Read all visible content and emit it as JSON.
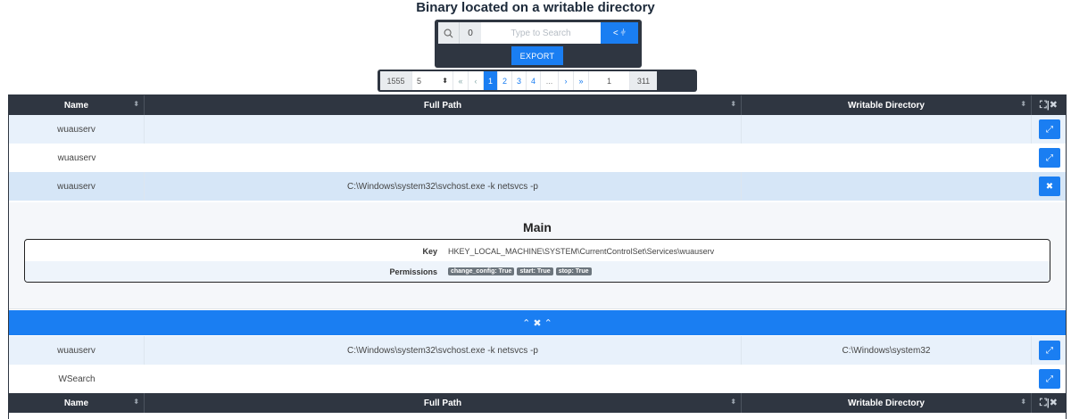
{
  "page": {
    "title": "Binary located on a writable directory"
  },
  "search": {
    "count": "0",
    "placeholder": "Type to Search",
    "filter_label": "< ⫩",
    "export_label": "EXPORT"
  },
  "pagination": {
    "total": "1555",
    "page_size": "5",
    "first": "«",
    "prev": "‹",
    "pages": [
      "1",
      "2",
      "3",
      "4",
      "..."
    ],
    "next": "›",
    "last_nav": "»",
    "goto": "1",
    "page_count": "311"
  },
  "table": {
    "columns": [
      "Name",
      "Full Path",
      "Writable Directory"
    ],
    "expand_all_icon": "⛶|✖",
    "rows": [
      {
        "name": "wuauserv",
        "full_path": "",
        "writable_dir": ""
      },
      {
        "name": "wuauserv",
        "full_path": "",
        "writable_dir": ""
      },
      {
        "name": "wuauserv",
        "full_path": "C:\\Windows\\system32\\svchost.exe -k netsvcs -p",
        "writable_dir": ""
      },
      {
        "name": "wuauserv",
        "full_path": "C:\\Windows\\system32\\svchost.exe -k netsvcs -p",
        "writable_dir": "C:\\Windows\\system32"
      },
      {
        "name": "WSearch",
        "full_path": "",
        "writable_dir": ""
      }
    ]
  },
  "detail": {
    "heading": "Main",
    "key_label": "Key",
    "key_value": "HKEY_LOCAL_MACHINE\\SYSTEM\\CurrentControlSet\\Services\\wuauserv",
    "permissions_label": "Permissions",
    "permissions": [
      "change_config: True",
      "start: True",
      "stop: True"
    ],
    "collapse_label": "⌃ ✖ ⌃"
  },
  "colors": {
    "accent": "#1a7ef2",
    "dark": "#2f3641",
    "row_alt": "#e8f1fb"
  }
}
